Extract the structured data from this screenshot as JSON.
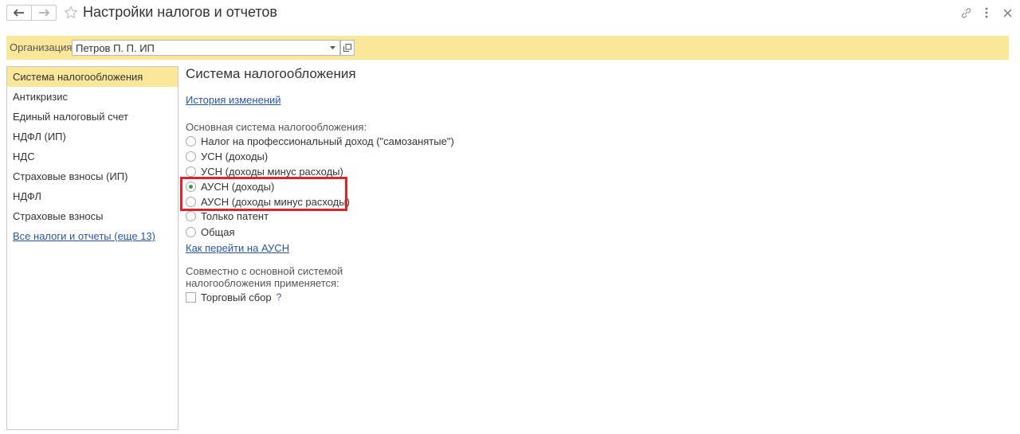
{
  "window": {
    "title": "Настройки налогов и отчетов",
    "icons": [
      "back-arrow-icon",
      "forward-arrow-icon",
      "star-icon",
      "link-icon",
      "more-icon",
      "close-icon"
    ]
  },
  "organization": {
    "label": "Организация:",
    "value": "Петров П. П. ИП"
  },
  "sidebar": {
    "items": [
      {
        "label": "Система налогообложения",
        "active": true
      },
      {
        "label": "Антикризис"
      },
      {
        "label": "Единый налоговый счет"
      },
      {
        "label": "НДФЛ (ИП)"
      },
      {
        "label": "НДС"
      },
      {
        "label": "Страховые взносы (ИП)"
      },
      {
        "label": "НДФЛ"
      },
      {
        "label": "Страховые взносы"
      }
    ],
    "all_link": "Все налоги и отчеты (еще 13)"
  },
  "main": {
    "title": "Система налогообложения",
    "history_link": "История изменений",
    "basic_label": "Основная система налогообложения:",
    "options": [
      {
        "label": "Налог на профессиональный доход (\"самозанятые\")",
        "checked": false
      },
      {
        "label": "УСН (доходы)",
        "checked": false
      },
      {
        "label": "УСН (доходы минус расходы)",
        "checked": false
      },
      {
        "label": "АУСН (доходы)",
        "checked": true
      },
      {
        "label": "АУСН (доходы минус расходы)",
        "checked": false
      },
      {
        "label": "Только патент",
        "checked": false
      },
      {
        "label": "Общая",
        "checked": false
      }
    ],
    "howto_link": "Как перейти на АУСН",
    "joint_label": "Совместно с основной системой налогообложения применяется:",
    "trade_fee": {
      "label": "Торговый сбор",
      "checked": false,
      "help": "?"
    }
  },
  "colors": {
    "accent_yellow": "#fae79a",
    "link_blue": "#2855a0",
    "highlight_red": "#d9262c",
    "radio_green": "#3d9b45"
  }
}
